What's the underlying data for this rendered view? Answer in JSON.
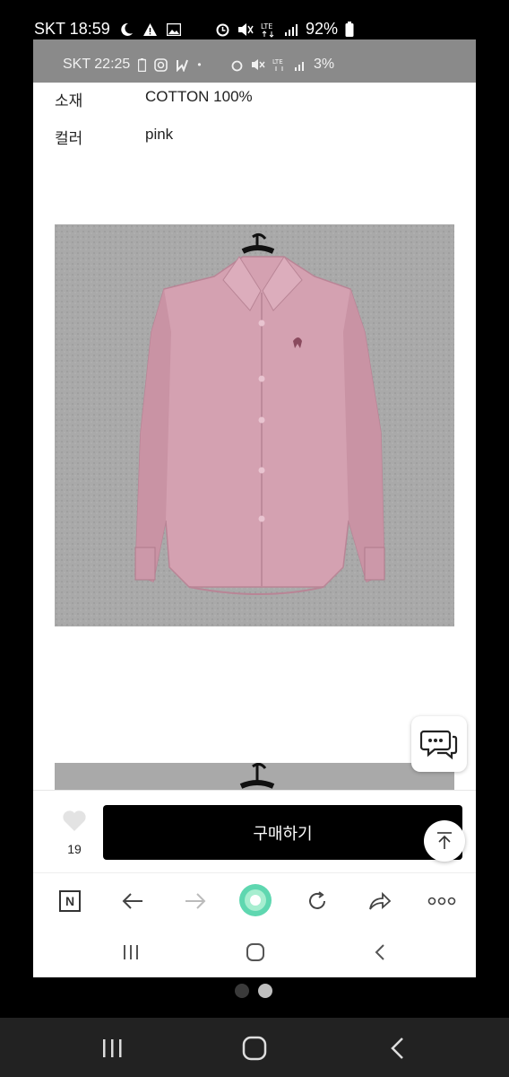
{
  "outer_status": {
    "carrier_time": "SKT 18:59",
    "battery": "92%",
    "icons": [
      "moon-icon",
      "warning-icon",
      "image-icon",
      "alarm-icon",
      "mute-icon",
      "lte-icon",
      "signal-icon",
      "battery-icon"
    ]
  },
  "inner_status": {
    "carrier_time": "SKT 22:25",
    "battery": "3%",
    "icons": [
      "battery-low-icon",
      "instagram-icon",
      "app-icon",
      "dot-icon",
      "alarm-icon",
      "mute-icon",
      "lte-icon",
      "signal-icon"
    ]
  },
  "specs": [
    {
      "label": "소재",
      "value": "COTTON 100%"
    },
    {
      "label": "컬러",
      "value": "pink"
    }
  ],
  "product_image": {
    "description_color": "#d7a3b3"
  },
  "bottom_bar": {
    "like_count": "19",
    "buy_label": "구매하기"
  },
  "browser_bar": {
    "naver_label": "N"
  },
  "colors": {
    "buy_button": "#000000",
    "accent_green": "#4cd9a8"
  },
  "pagination": {
    "current": 2,
    "total": 2
  }
}
